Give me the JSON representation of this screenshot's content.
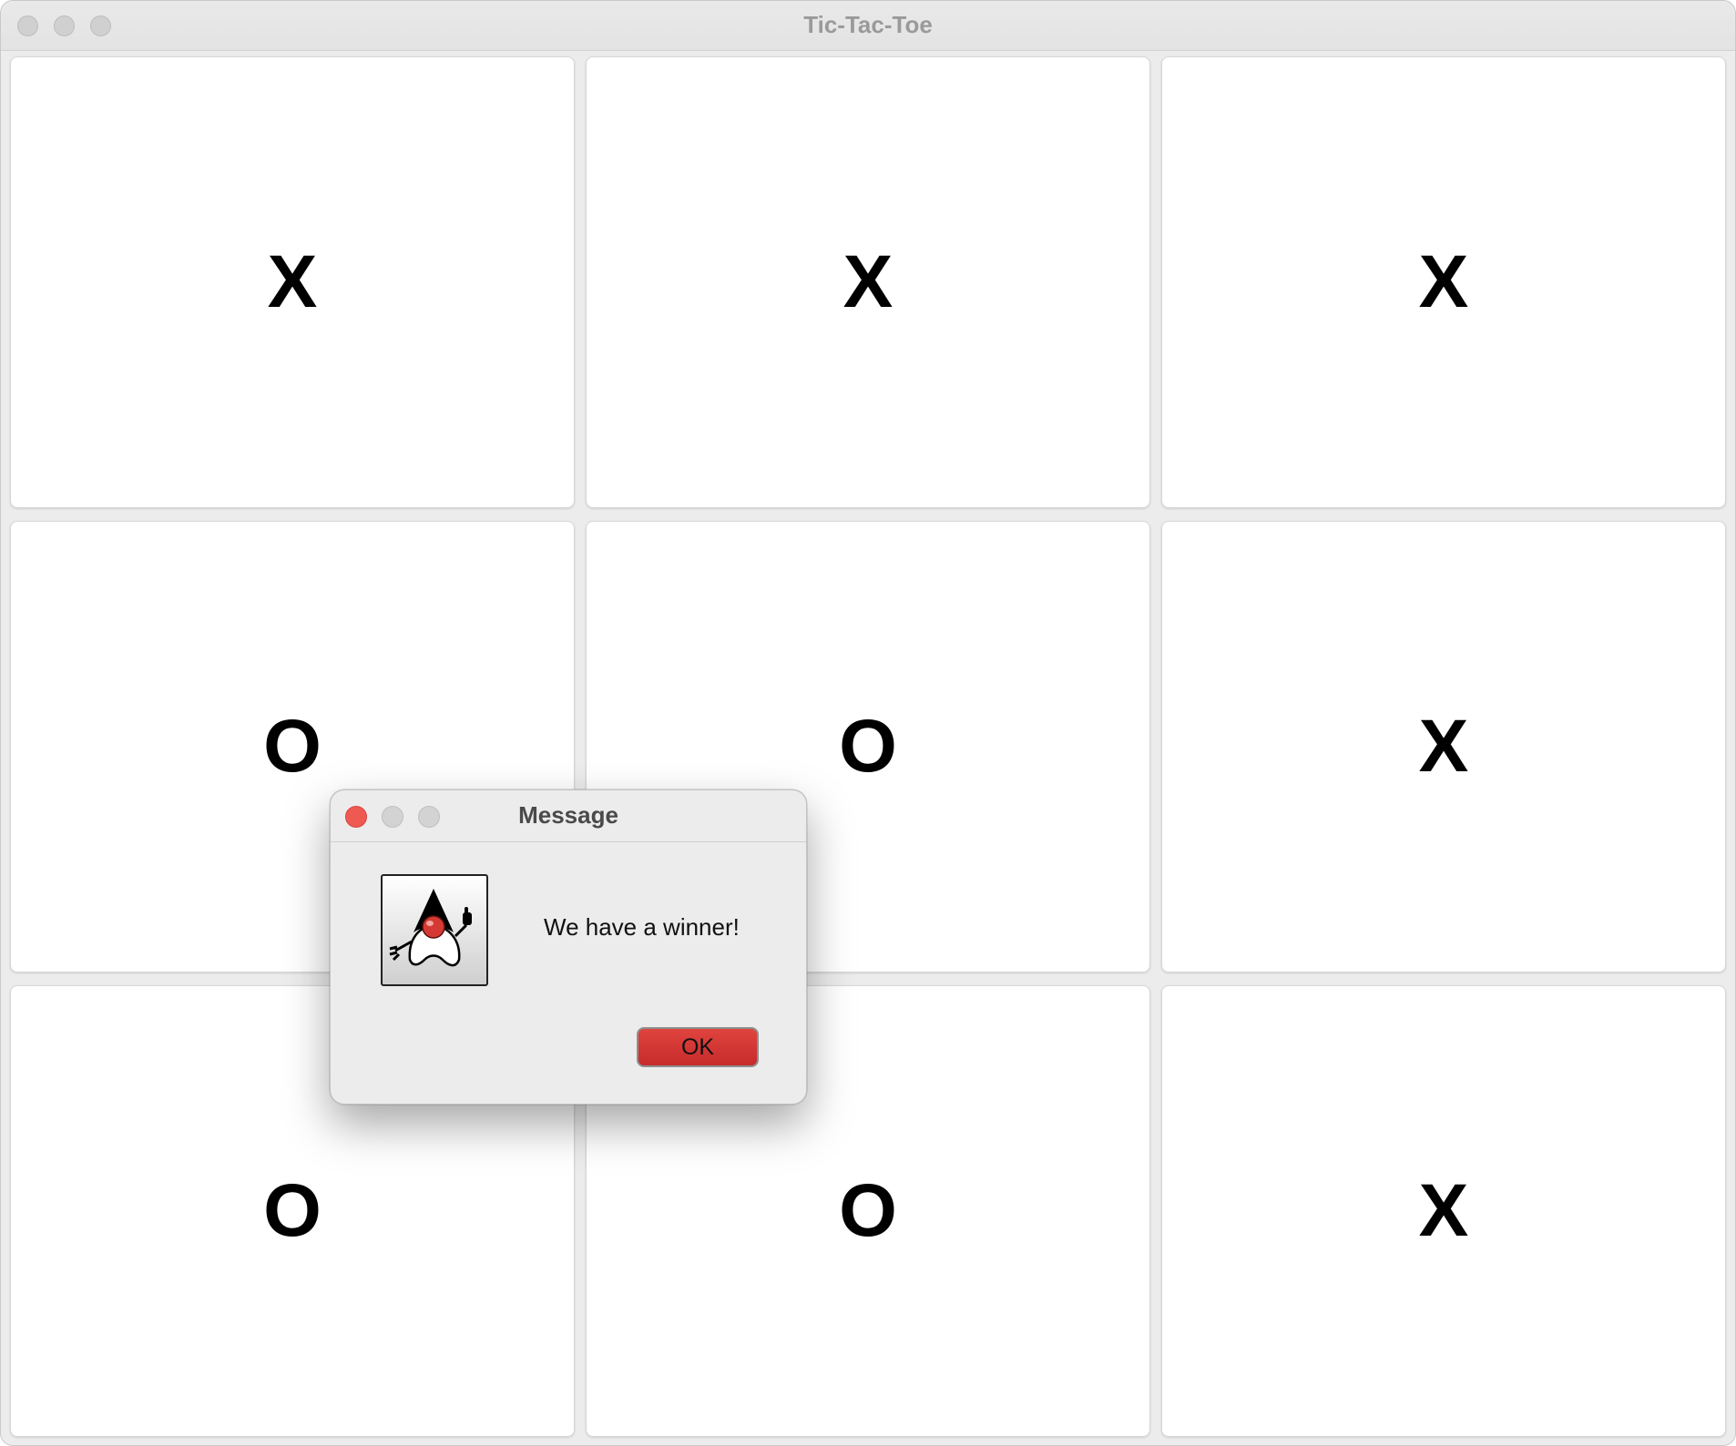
{
  "window": {
    "title": "Tic-Tac-Toe"
  },
  "board": {
    "cells": [
      {
        "mark": "X"
      },
      {
        "mark": "X"
      },
      {
        "mark": "X"
      },
      {
        "mark": "O"
      },
      {
        "mark": "O"
      },
      {
        "mark": "X"
      },
      {
        "mark": "O"
      },
      {
        "mark": "O"
      },
      {
        "mark": "X"
      }
    ]
  },
  "dialog": {
    "title": "Message",
    "message": "We have a winner!",
    "ok_label": "OK",
    "icon": "java-duke-icon"
  },
  "colors": {
    "close_red": "#ee5a52",
    "ok_button_red": "#d13a36"
  }
}
